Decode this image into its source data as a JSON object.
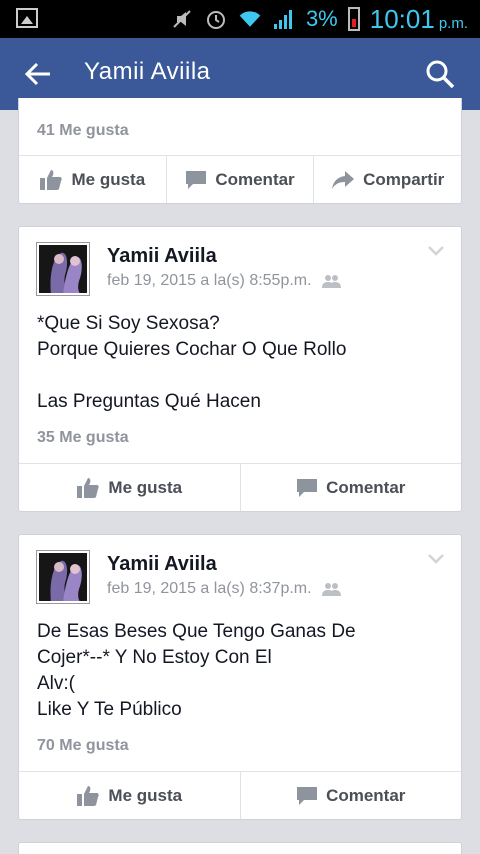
{
  "status_bar": {
    "battery_percent": "3%",
    "time": "10:01",
    "ampm": "p.m."
  },
  "app_bar": {
    "title": "Yamii Aviila"
  },
  "posts": [
    {
      "likes": "41 Me gusta",
      "actions": [
        "Me gusta",
        "Comentar",
        "Compartir"
      ]
    },
    {
      "author": "Yamii Aviila",
      "date": "feb 19, 2015 a la(s) 8:55p.m.",
      "text": "*Que Si Soy Sexosa?\nPorque Quieres  Cochar O Que Rollo\n\nLas Preguntas  Qué  Hacen",
      "likes": "35 Me gusta",
      "actions": [
        "Me gusta",
        "Comentar"
      ]
    },
    {
      "author": "Yamii Aviila",
      "date": "feb 19, 2015 a la(s) 8:37p.m.",
      "text": "De Esas Beses Que Tengo  Ganas De\nCojer*--* Y No Estoy Con El\nAlv:(\nLike  Y Te Público",
      "likes": "70 Me gusta",
      "actions": [
        "Me gusta",
        "Comentar"
      ]
    }
  ]
}
